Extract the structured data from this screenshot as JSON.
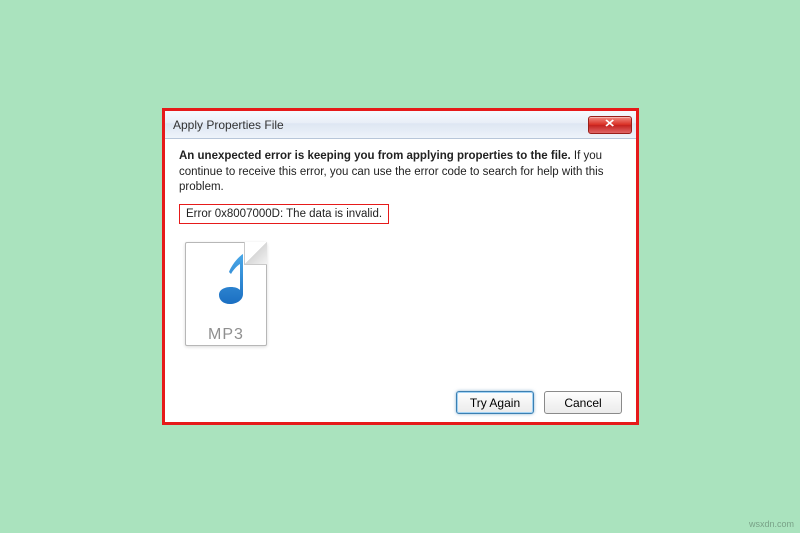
{
  "dialog": {
    "title": "Apply Properties File",
    "close_glyph": "✕",
    "message_bold": "An unexpected error is keeping you from applying properties to the file.",
    "message_rest": " If you continue to receive this error, you can use the error code to search for help with this problem.",
    "error_line": "Error 0x8007000D: The data is invalid.",
    "icon_label": "MP3",
    "buttons": {
      "try_again": "Try Again",
      "cancel": "Cancel"
    }
  },
  "watermark": "wsxdn.com"
}
